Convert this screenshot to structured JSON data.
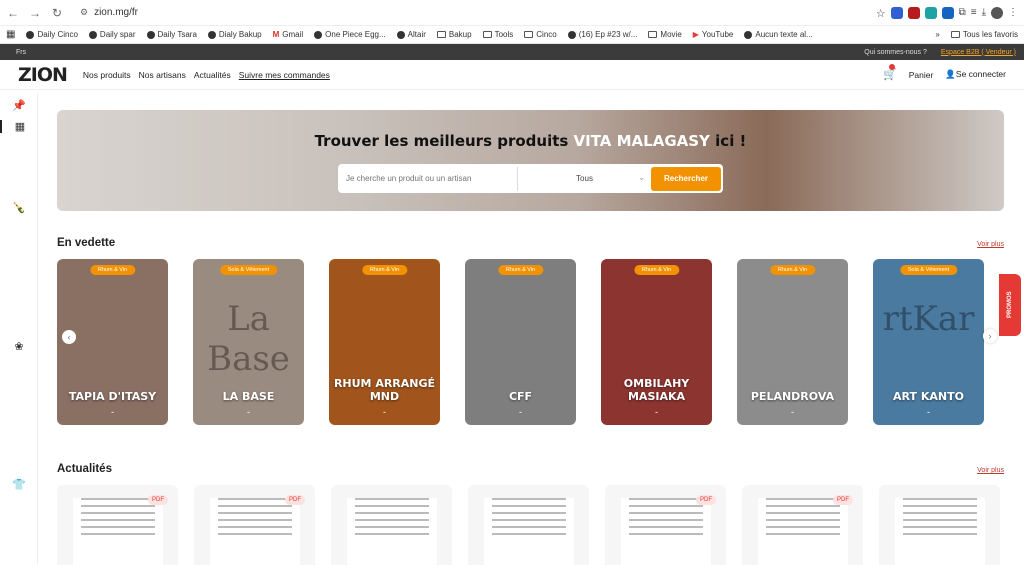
{
  "browser": {
    "url": "zion.mg/fr",
    "bookmarks": [
      {
        "label": "Daily Cinco",
        "icon": "globe-icon"
      },
      {
        "label": "Daily spar",
        "icon": "globe-icon"
      },
      {
        "label": "Daily Tsara",
        "icon": "globe-icon"
      },
      {
        "label": "Dialy Bakup",
        "icon": "globe-icon"
      },
      {
        "label": "Gmail",
        "icon": "gmail-icon"
      },
      {
        "label": "One Piece Egg...",
        "icon": "globe-icon"
      },
      {
        "label": "Altair",
        "icon": "globe-icon"
      },
      {
        "label": "Bakup",
        "icon": "folder-icon"
      },
      {
        "label": "Tools",
        "icon": "folder-icon"
      },
      {
        "label": "Cinco",
        "icon": "folder-icon"
      },
      {
        "label": "(16) Ep #23 w/...",
        "icon": "globe-icon"
      },
      {
        "label": "Movie",
        "icon": "folder-icon"
      },
      {
        "label": "YouTube",
        "icon": "youtube-icon"
      },
      {
        "label": "Aucun texte al...",
        "icon": "globe-icon"
      }
    ],
    "all_bookmarks": "Tous les favoris",
    "more": "»"
  },
  "topbar": {
    "lang": "Frs",
    "about": "Qui sommes-nous ?",
    "b2b": "Espace B2B ( Vendeur )"
  },
  "header": {
    "logo": "ZION",
    "menu": [
      "Nos produits",
      "Nos artisans",
      "Actualités",
      "Suivre mes commandes"
    ],
    "cart": "Panier",
    "login": "Se connecter"
  },
  "hero": {
    "title_prefix": "Trouver les meilleurs produits ",
    "title_highlight": "VITA MALAGASY",
    "title_suffix": " ici !",
    "search_placeholder": "Je cherche un produit ou un artisan",
    "select_value": "Tous",
    "search_button": "Rechercher"
  },
  "featured": {
    "title": "En vedette",
    "see_more": "Voir plus",
    "cards": [
      {
        "tag": "Rhum & Vin",
        "name": "TAPIA D'ITASY",
        "dash": "-",
        "bg": "#8a6f63",
        "art": ""
      },
      {
        "tag": "Sola & Vêtement",
        "name": "LA BASE",
        "dash": "-",
        "bg": "#9a8b80",
        "art": "La Base"
      },
      {
        "tag": "Rhum & Vin",
        "name": "RHUM ARRANGÉ MND",
        "dash": "-",
        "bg": "#a1541c",
        "art": ""
      },
      {
        "tag": "Rhum & Vin",
        "name": "CFF",
        "dash": "-",
        "bg": "#7e7e7e",
        "art": ""
      },
      {
        "tag": "Rhum & Vin",
        "name": "OMBILAHY MASIAKA",
        "dash": "-",
        "bg": "#8c3430",
        "art": ""
      },
      {
        "tag": "Rhum & Vin",
        "name": "PELANDROVA",
        "dash": "-",
        "bg": "#8c8c8c",
        "art": ""
      },
      {
        "tag": "Sola & Vêtement",
        "name": "ART KANTO",
        "dash": "-",
        "bg": "#4a7aa0",
        "art": "rtKar"
      }
    ]
  },
  "news": {
    "title": "Actualités",
    "see_more": "Voir plus",
    "cards": [
      {
        "badge": "PDF"
      },
      {
        "badge": "PDF"
      },
      {
        "badge": ""
      },
      {
        "badge": ""
      },
      {
        "badge": "PDF"
      },
      {
        "badge": "PDF"
      },
      {
        "badge": ""
      }
    ]
  },
  "promos": "PROMOS"
}
